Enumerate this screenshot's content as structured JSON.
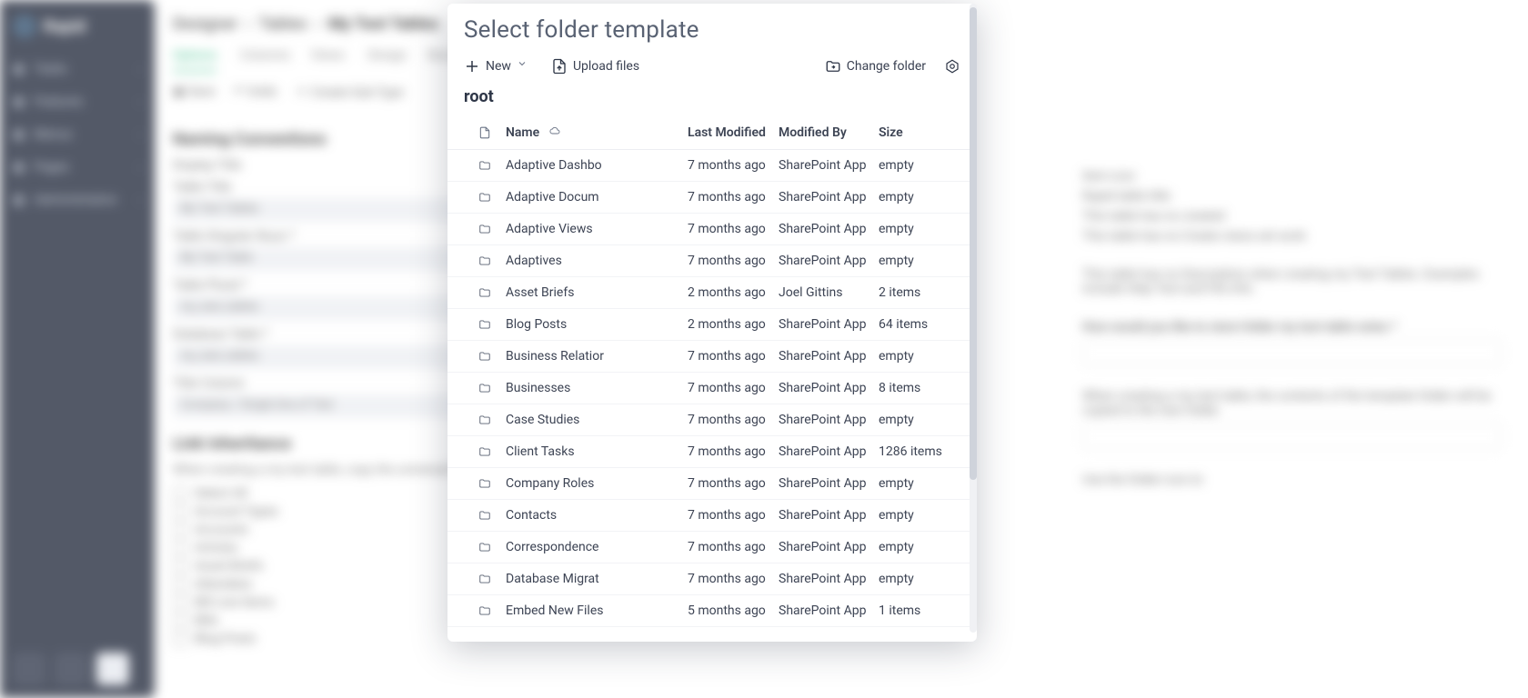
{
  "sidebar": {
    "brand": "Rapid",
    "items": [
      {
        "label": "Tasks"
      },
      {
        "label": "Features"
      },
      {
        "label": "Menus"
      },
      {
        "label": "Pages"
      },
      {
        "label": "Administration"
      }
    ]
  },
  "breadcrumb": {
    "a": "Designer",
    "b": "Tables",
    "c": "My Test Tables"
  },
  "tabs": [
    "Options",
    "Columns",
    "Views",
    "Design",
    "Security",
    "More"
  ],
  "toolbar_bg": {
    "save": "Save",
    "undo": "Undo",
    "create": "Create Sub-Type"
  },
  "naming": {
    "heading": "Naming Conventions",
    "labels": [
      "Display Title",
      "Table Singular Noun *",
      "Table Plural *",
      "Database Table *",
      "Title Column"
    ],
    "values": [
      "My Test Tables",
      "My Test Table",
      "my_test_tables",
      "my_test_tables",
      "Company / Single line of Text"
    ],
    "tbl_label": "Table Title",
    "tbl_value": "My Test Tables"
  },
  "inheritance": {
    "heading": "Link Inheritance",
    "desc": "When creating a my test table, copy the universal link of the parent item for the following links for this item.",
    "select_all": "Select All",
    "items": [
      "Account Types",
      "Accounts",
      "Articles",
      "Asset Briefs",
      "Attendees",
      "Bill Line Items",
      "Bills",
      "Blog Posts"
    ]
  },
  "right": {
    "lines": [
      "Item icon",
      "Rapid table title",
      "This table has no created",
      "This table has no Create views set work"
    ],
    "line2": "This table has no Description when creating my Test Tables. Examples include Help Text and File Info.",
    "folder_q": "How would you like to store folder my test table notes *",
    "tmpl_hint": "When creating a my test table, the contents of the template folder will be copied to the new folder.",
    "tmpl_input": "Use the folder icon to"
  },
  "dialog": {
    "title": "Select folder template",
    "new_label": "New",
    "upload_label": "Upload files",
    "change_label": "Change folder",
    "path": "root",
    "columns": {
      "name": "Name",
      "modified": "Last Modified",
      "by": "Modified By",
      "size": "Size"
    },
    "rows": [
      {
        "name": "Adaptive Dashbo",
        "modified": "7 months ago",
        "by": "SharePoint App",
        "size": "empty"
      },
      {
        "name": "Adaptive Docum",
        "modified": "7 months ago",
        "by": "SharePoint App",
        "size": "empty"
      },
      {
        "name": "Adaptive Views",
        "modified": "7 months ago",
        "by": "SharePoint App",
        "size": "empty"
      },
      {
        "name": "Adaptives",
        "modified": "7 months ago",
        "by": "SharePoint App",
        "size": "empty"
      },
      {
        "name": "Asset Briefs",
        "modified": "2 months ago",
        "by": "Joel Gittins",
        "size": "2 items"
      },
      {
        "name": "Blog Posts",
        "modified": "2 months ago",
        "by": "SharePoint App",
        "size": "64 items"
      },
      {
        "name": "Business Relatior",
        "modified": "7 months ago",
        "by": "SharePoint App",
        "size": "empty"
      },
      {
        "name": "Businesses",
        "modified": "7 months ago",
        "by": "SharePoint App",
        "size": "8 items"
      },
      {
        "name": "Case Studies",
        "modified": "7 months ago",
        "by": "SharePoint App",
        "size": "empty"
      },
      {
        "name": "Client Tasks",
        "modified": "7 months ago",
        "by": "SharePoint App",
        "size": "1286 items"
      },
      {
        "name": "Company Roles",
        "modified": "7 months ago",
        "by": "SharePoint App",
        "size": "empty"
      },
      {
        "name": "Contacts",
        "modified": "7 months ago",
        "by": "SharePoint App",
        "size": "empty"
      },
      {
        "name": "Correspondence",
        "modified": "7 months ago",
        "by": "SharePoint App",
        "size": "empty"
      },
      {
        "name": "Database Migrat",
        "modified": "7 months ago",
        "by": "SharePoint App",
        "size": "empty"
      },
      {
        "name": "Embed New Files",
        "modified": "5 months ago",
        "by": "SharePoint App",
        "size": "1 items"
      }
    ]
  }
}
